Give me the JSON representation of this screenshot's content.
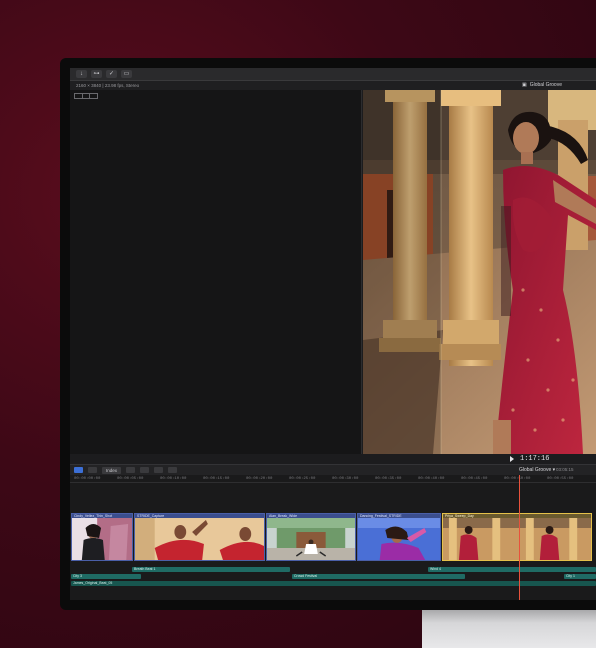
{
  "toolbar": {
    "buttons": [
      {
        "icon": "import-icon",
        "glyph": "↓"
      },
      {
        "icon": "keyword-icon",
        "glyph": "⊶"
      },
      {
        "icon": "check-icon",
        "glyph": "✓"
      },
      {
        "icon": "share-icon",
        "glyph": "▭"
      }
    ]
  },
  "infobar": {
    "format": "2160 × 3840 | 23.98 fps, Stereo",
    "project_name": "Global Groove",
    "project_icon": "film-icon"
  },
  "viewer": {
    "timecode": "1:17:16"
  },
  "timeline": {
    "index_label": "Index",
    "project_name": "Global Groove",
    "project_dropdown": "▾",
    "duration": "03:05:15",
    "ruler": [
      "00:00:00:00",
      "00:00:05:00",
      "00:00:10:00",
      "00:00:15:00",
      "00:00:20:00",
      "00:00:25:00",
      "00:00:30:00",
      "00:00:35:00",
      "00:00:40:00",
      "00:00:45:00",
      "00:00:50:00",
      "00:00:55:00"
    ],
    "clips": [
      {
        "label": "Cindy_Vellez_Thin_Shot"
      },
      {
        "label": "STRIDE_Capture"
      },
      {
        "label": "Alan_Break_Wide"
      },
      {
        "label": "Dancing_Festival_STRIDE"
      },
      {
        "label": "Priya_Sweep_Day"
      }
    ],
    "audio_clips": [
      {
        "label": "Breath Beat 1"
      },
      {
        "label": "Wind 4"
      },
      {
        "label": "City 3"
      },
      {
        "label": "Crowd Festival"
      },
      {
        "label": "City 1"
      },
      {
        "label": "James_Original_Beat_05"
      }
    ]
  },
  "colors": {
    "accent": "#3c6fd6",
    "playhead": "#e8523c",
    "selection": "#e5c14a",
    "audio": "#1f6b64"
  }
}
